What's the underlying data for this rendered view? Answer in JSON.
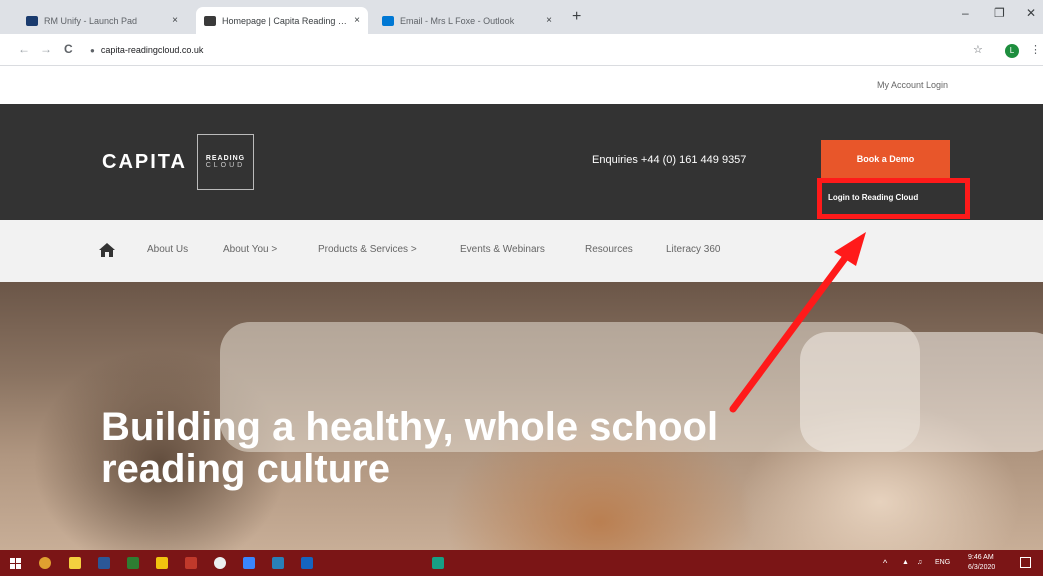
{
  "browser": {
    "tabs": [
      {
        "label": "RM Unify - Launch Pad",
        "favicon_color": "#1a3b6e",
        "close": "×"
      },
      {
        "label": "Homepage | Capita Reading Clo...",
        "favicon_color": "#3a3a3a",
        "close": "×"
      },
      {
        "label": "Email - Mrs L Foxe - Outlook",
        "favicon_color": "#0078d4",
        "close": "×"
      }
    ],
    "new_tab": "+",
    "window_controls": {
      "minimize": "–",
      "maximize": "❐",
      "close": "✕"
    },
    "nav": {
      "back": "←",
      "forward": "→",
      "reload": "C"
    },
    "url": "capita-readingcloud.co.uk",
    "profile_initial": "L"
  },
  "site": {
    "account_link": "My Account Login",
    "logo": {
      "word": "CAPITA",
      "box_line1": "READING",
      "box_line2": "CLOUD"
    },
    "enquiries": "Enquiries +44 (0) 161 449 9357",
    "demo_button": "Book a Demo",
    "login_link": "Login to Reading Cloud",
    "nav_items": [
      "About Us",
      "About You >",
      "Products & Services >",
      "Events & Webinars",
      "Resources",
      "Literacy 360"
    ],
    "hero_title": "Building a healthy, whole school reading culture"
  },
  "colors": {
    "accent": "#e8562a",
    "header": "#333333",
    "highlight": "#ff1a1a",
    "taskbar": "#7b1516"
  },
  "taskbar": {
    "apps": [
      {
        "name": "windows-start-icon",
        "color": "#ffffff"
      },
      {
        "name": "chrome-icon",
        "color": "#e0a030"
      },
      {
        "name": "store-icon",
        "color": "#f4d03f"
      },
      {
        "name": "word-icon",
        "color": "#2b5797"
      },
      {
        "name": "excel-icon",
        "color": "#2e7d32"
      },
      {
        "name": "mail-icon",
        "color": "#f1c40f"
      },
      {
        "name": "powerpoint-icon",
        "color": "#c0392b"
      },
      {
        "name": "onedrive-icon",
        "color": "#ecf0f1"
      },
      {
        "name": "teams-icon",
        "color": "#3a86ff"
      },
      {
        "name": "photos-icon",
        "color": "#2980b9"
      },
      {
        "name": "outlook-icon",
        "color": "#1565c0"
      },
      {
        "name": "app-icon",
        "color": "#16a085"
      }
    ],
    "tray": {
      "chevron": "^",
      "lang": "ENG",
      "time": "9:46 AM",
      "date": "6/3/2020"
    }
  }
}
